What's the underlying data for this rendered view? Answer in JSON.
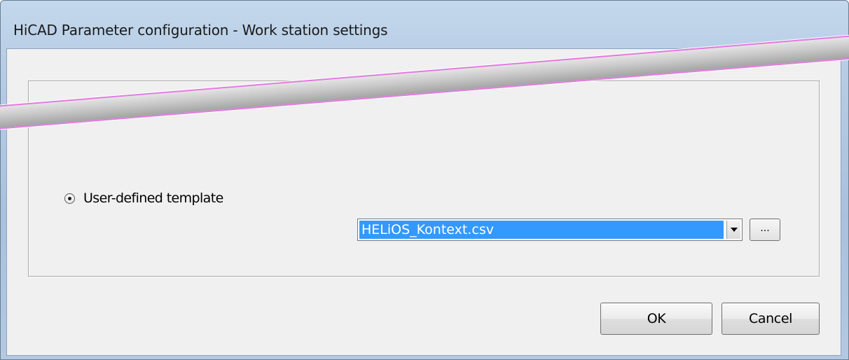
{
  "window": {
    "title": "HiCAD Parameter configuration - Work station settings"
  },
  "options": {
    "template_radio_label": "User-defined template",
    "template_radio_selected": true
  },
  "template_select": {
    "value": "HELiOS_Kontext.csv",
    "browse_label": "..."
  },
  "buttons": {
    "ok": "OK",
    "cancel": "Cancel"
  },
  "colors": {
    "selection": "#3399ff",
    "streak_border": "#e37ae0",
    "dialog_bg": "#f0f0f0"
  },
  "icons": {
    "radio": "radio-selected-icon",
    "dropdown": "chevron-down-icon"
  }
}
